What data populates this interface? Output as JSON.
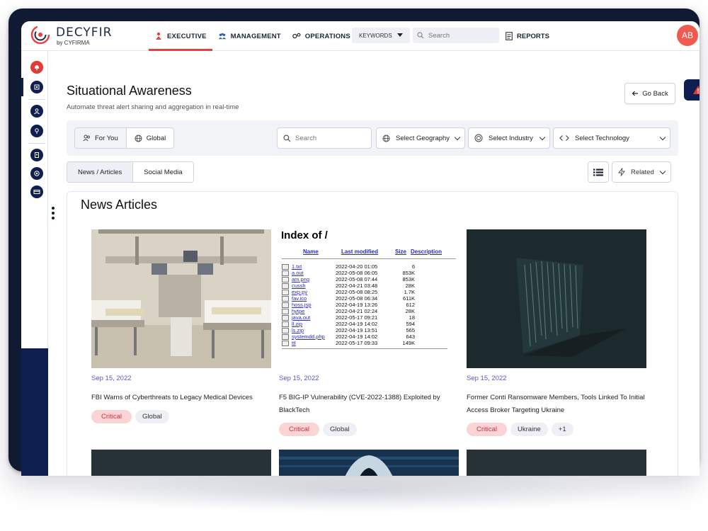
{
  "header": {
    "logo_name": "DECYFIR",
    "logo_sub": "by CYFIRMA",
    "nav": [
      {
        "label": "EXECUTIVE",
        "icon": "executive-icon",
        "active": true
      },
      {
        "label": "MANAGEMENT",
        "icon": "management-icon",
        "active": false
      },
      {
        "label": "OPERATIONS",
        "icon": "operations-icon",
        "active": false
      }
    ],
    "keywords_label": "KEYWORDS",
    "search_placeholder": "Search",
    "reports_label": "REPORTS",
    "avatar_initials": "AB"
  },
  "page": {
    "title": "Situational Awareness",
    "subtitle": "Automate threat alert sharing and aggregation in real-time",
    "back_label": "Go Back"
  },
  "filters": {
    "scope": [
      "For You",
      "Global"
    ],
    "search_placeholder": "Search",
    "geography": "Select Geography",
    "industry": "Select Industry",
    "technology": "Select Technology"
  },
  "tabs": [
    "News / Articles",
    "Social Media"
  ],
  "sort": {
    "label": "Related"
  },
  "panel_title": "News Articles",
  "articles": [
    {
      "date": "Sep 15, 2022",
      "title": "FBI Warns of Cyberthreats to Legacy Medical Devices",
      "tags": [
        "Critical",
        "Global"
      ]
    },
    {
      "date": "Sep 15, 2022",
      "title": "F5 BIG-IP Vulnerability (CVE-2022-1388) Exploited by BlackTech",
      "tags": [
        "Critical",
        "Global"
      ]
    },
    {
      "date": "Sep 15, 2022",
      "title": "Former Conti Ransomware Members, Tools Linked To Initial Access Broker Targeting Ukraine",
      "tags": [
        "Critical",
        "Ukraine",
        "+1"
      ]
    }
  ],
  "index_listing": {
    "heading": "Index of /",
    "columns": [
      "Name",
      "Last modified",
      "Size",
      "Description"
    ],
    "rows": [
      {
        "name": "1.txt",
        "date": "2022-04-20 01:05",
        "size": "6"
      },
      {
        "name": "a.out",
        "date": "2022-05-08 06:05",
        "size": "853K"
      },
      {
        "name": "am.png",
        "date": "2022-05-08 07:44",
        "size": "853K"
      },
      {
        "name": "cussh",
        "date": "2022-04-21 03:48",
        "size": "28K"
      },
      {
        "name": "exp.py",
        "date": "2022-05-08 08:25",
        "size": "1.7K"
      },
      {
        "name": "fav.ico",
        "date": "2022-05-08 06:34",
        "size": "611K"
      },
      {
        "name": "hoss.jsp",
        "date": "2022-04-19 13:26",
        "size": "612"
      },
      {
        "name": "hytpe",
        "date": "2022-04-21 02:24",
        "size": "28K"
      },
      {
        "name": "java.out",
        "date": "2022-05-17 09:21",
        "size": "18"
      },
      {
        "name": "ll.zip",
        "date": "2022-04-19 14:02",
        "size": "594"
      },
      {
        "name": "ls.zip",
        "date": "2022-04-19 13:51",
        "size": "565"
      },
      {
        "name": "systemdd.php",
        "date": "2022-04-19 14:02",
        "size": "643"
      },
      {
        "name": "ttl",
        "date": "2022-05-17 09:33",
        "size": "149K"
      }
    ]
  },
  "colors": {
    "accent_red": "#e84141",
    "navy": "#0e1f4f",
    "date_purple": "#5a58c8",
    "critical_bg": "#fbd4d6"
  }
}
